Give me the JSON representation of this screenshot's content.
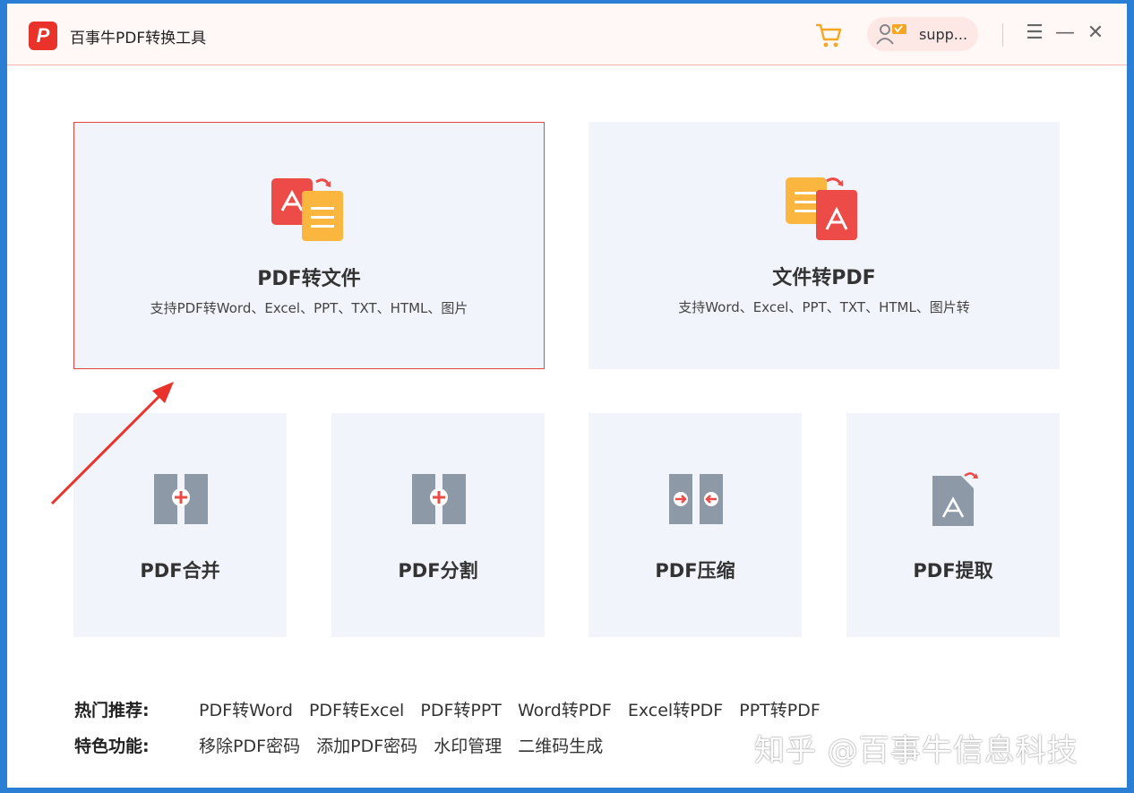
{
  "app": {
    "title": "百事牛PDF转换工具",
    "logo_letter": "P"
  },
  "header": {
    "user_name": "supp..."
  },
  "main": {
    "big_cards": [
      {
        "title": "PDF转文件",
        "subtitle": "支持PDF转Word、Excel、PPT、TXT、HTML、图片"
      },
      {
        "title": "文件转PDF",
        "subtitle": "支持Word、Excel、PPT、TXT、HTML、图片转"
      }
    ],
    "small_cards": [
      {
        "title": "PDF合并"
      },
      {
        "title": "PDF分割"
      },
      {
        "title": "PDF压缩"
      },
      {
        "title": "PDF提取"
      }
    ]
  },
  "footer": {
    "hot_label": "热门推荐:",
    "hot_links": [
      "PDF转Word",
      "PDF转Excel",
      "PDF转PPT",
      "Word转PDF",
      "Excel转PDF",
      "PPT转PDF"
    ],
    "feature_label": "特色功能:",
    "feature_links": [
      "移除PDF密码",
      "添加PDF密码",
      "水印管理",
      "二维码生成"
    ]
  },
  "watermark": "知乎 @百事牛信息科技",
  "colors": {
    "accent": "#e2463e",
    "card_bg": "#f1f5fb",
    "icon_gray": "#8e99a8",
    "doc_yellow": "#fbb640",
    "pdf_red": "#ec4b47"
  }
}
